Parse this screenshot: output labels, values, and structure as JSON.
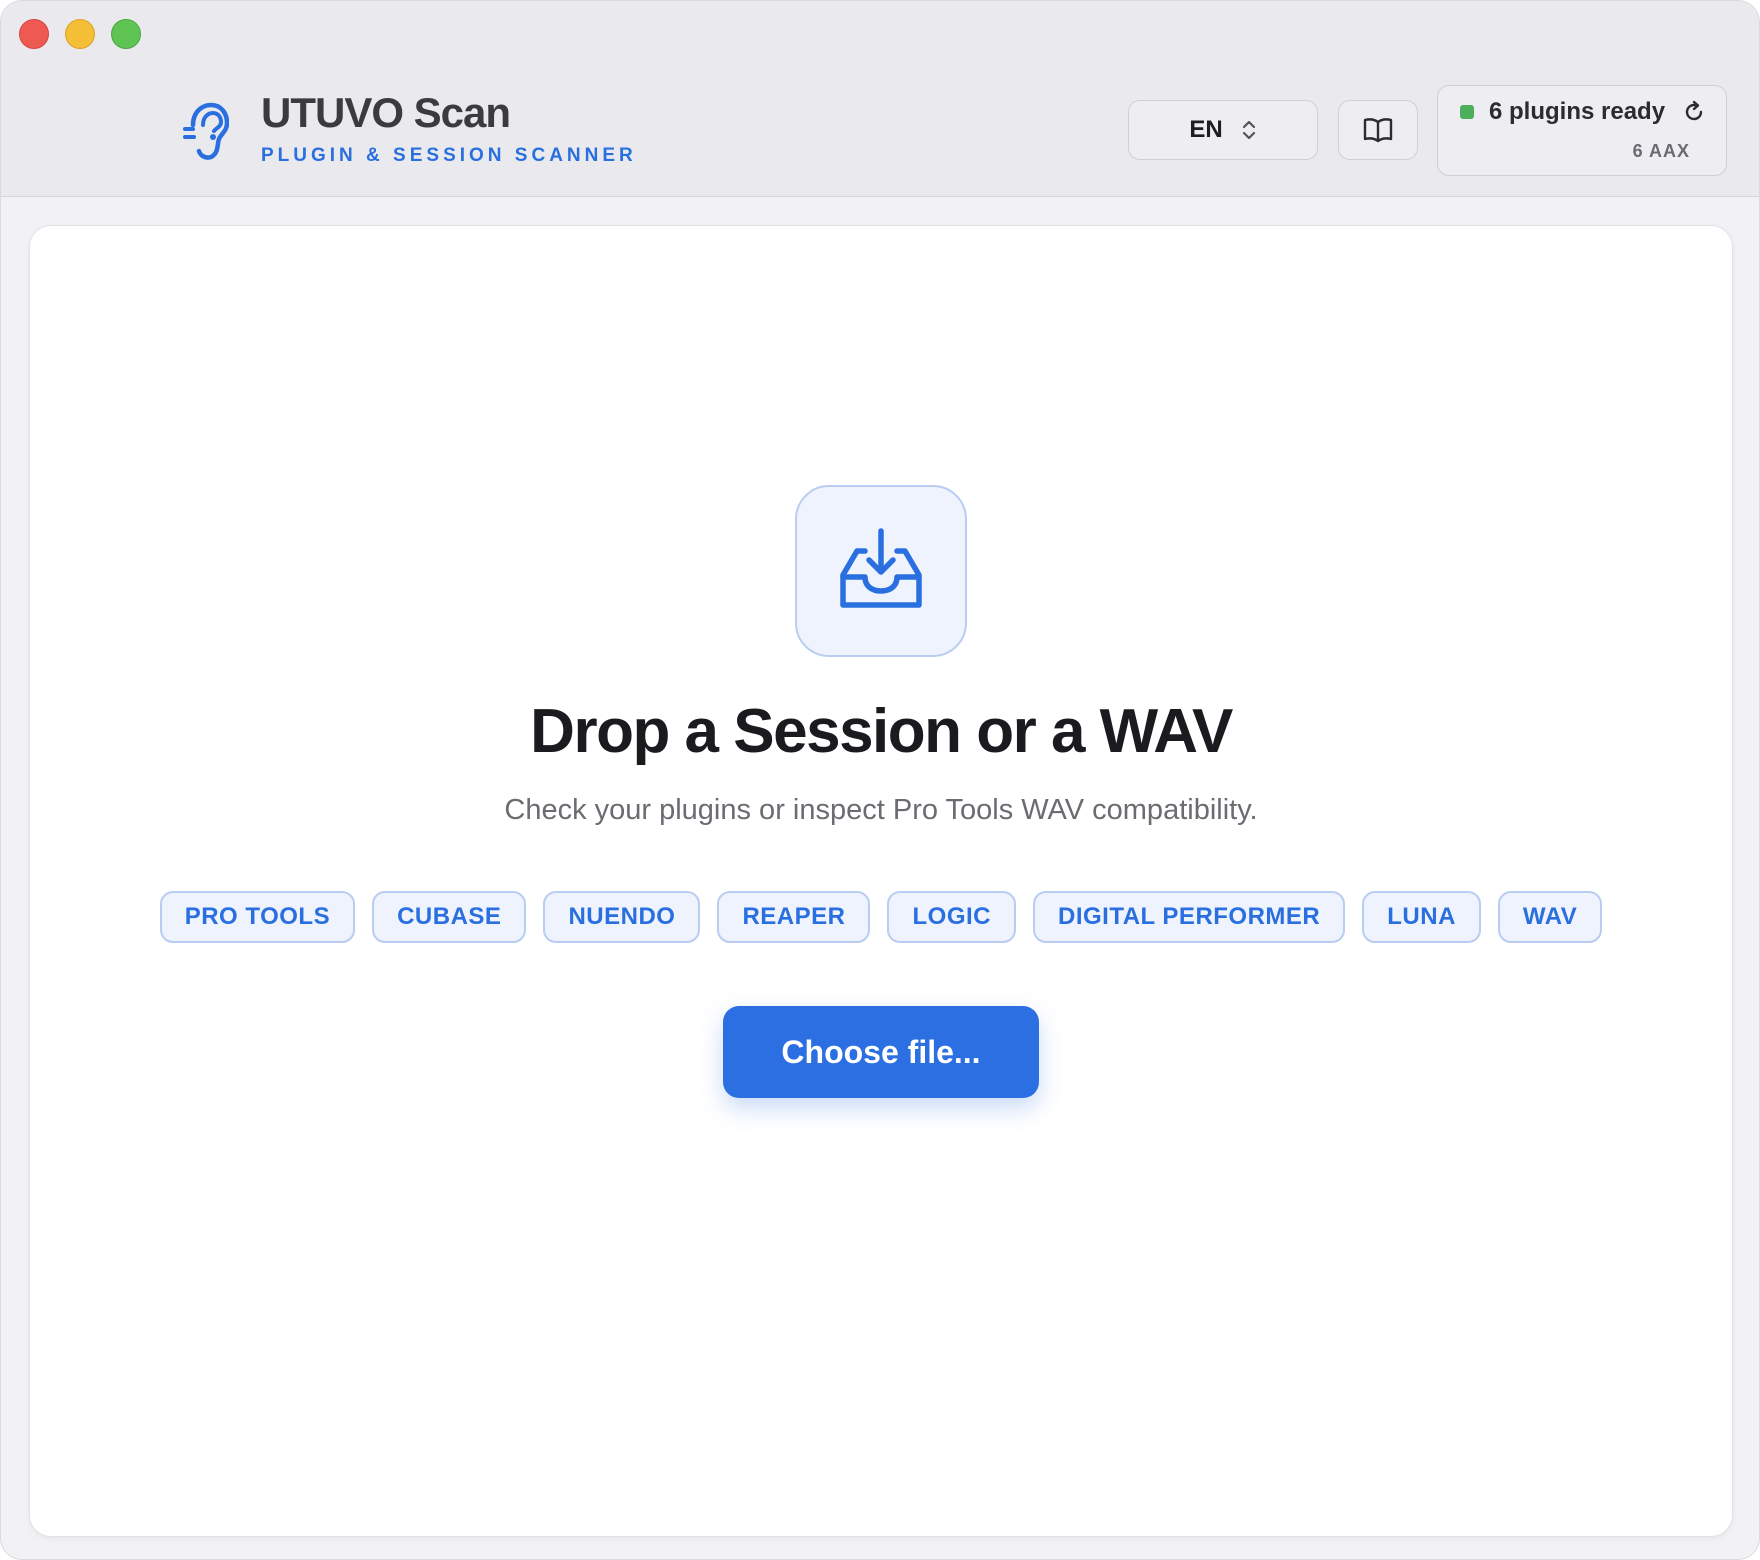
{
  "brand": {
    "title": "UTUVO Scan",
    "subtitle": "PLUGIN & SESSION SCANNER",
    "icon": "ear-icon"
  },
  "toolbar": {
    "language": "EN",
    "language_icon": "chevron-updown-icon",
    "manual_icon": "book-icon"
  },
  "status": {
    "text": "6 plugins ready",
    "count": "6 AAX",
    "indicator_color": "#4caf5c",
    "refresh_icon": "refresh-icon"
  },
  "drop_zone": {
    "icon": "inbox-download-icon",
    "title": "Drop a Session or a WAV",
    "subtitle": "Check your plugins or inspect Pro Tools WAV compatibility.",
    "formats": [
      "PRO TOOLS",
      "CUBASE",
      "NUENDO",
      "REAPER",
      "LOGIC",
      "DIGITAL PERFORMER",
      "LUNA",
      "WAV"
    ],
    "button_label": "Choose file..."
  },
  "colors": {
    "accent": "#2b6fe3",
    "chip_bg": "#eef3fd",
    "chip_border": "#b9cdf2"
  }
}
